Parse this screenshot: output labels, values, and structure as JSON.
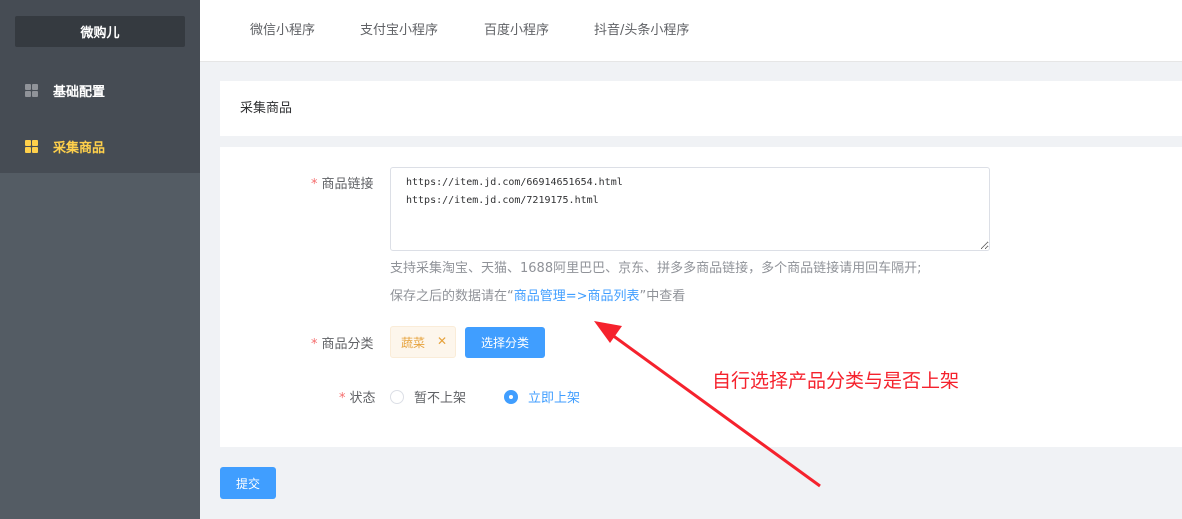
{
  "sidebar": {
    "brand": "微购儿",
    "items": [
      {
        "label": "基础配置",
        "icon": "grid-icon",
        "active": false
      },
      {
        "label": "采集商品",
        "icon": "grid-icon",
        "active": true
      }
    ]
  },
  "topbar": {
    "tabs": [
      "微信小程序",
      "支付宝小程序",
      "百度小程序",
      "抖音/头条小程序"
    ]
  },
  "card": {
    "title": "采集商品"
  },
  "form": {
    "link_label": "商品链接",
    "link_value": "https://item.jd.com/66914651654.html\nhttps://item.jd.com/7219175.html",
    "hint_line1": "支持采集淘宝、天猫、1688阿里巴巴、京东、拼多多商品链接，多个商品链接请用回车隔开;",
    "hint_line2_prefix": "保存之后的数据请在“",
    "hint_line2_link": "商品管理=>商品列表",
    "hint_line2_suffix": "”中查看",
    "category_label": "商品分类",
    "category_tag": "蔬菜",
    "category_button": "选择分类",
    "status_label": "状态",
    "status_options": [
      "暂不上架",
      "立即上架"
    ],
    "status_selected": "立即上架",
    "submit": "提交"
  },
  "annotation": {
    "text": "自行选择产品分类与是否上架",
    "color": "#f5222d"
  },
  "colors": {
    "primary": "#409eff",
    "sidebar_bg": "#545c64",
    "active_menu": "#ffd04b",
    "required": "#f56c6c"
  }
}
